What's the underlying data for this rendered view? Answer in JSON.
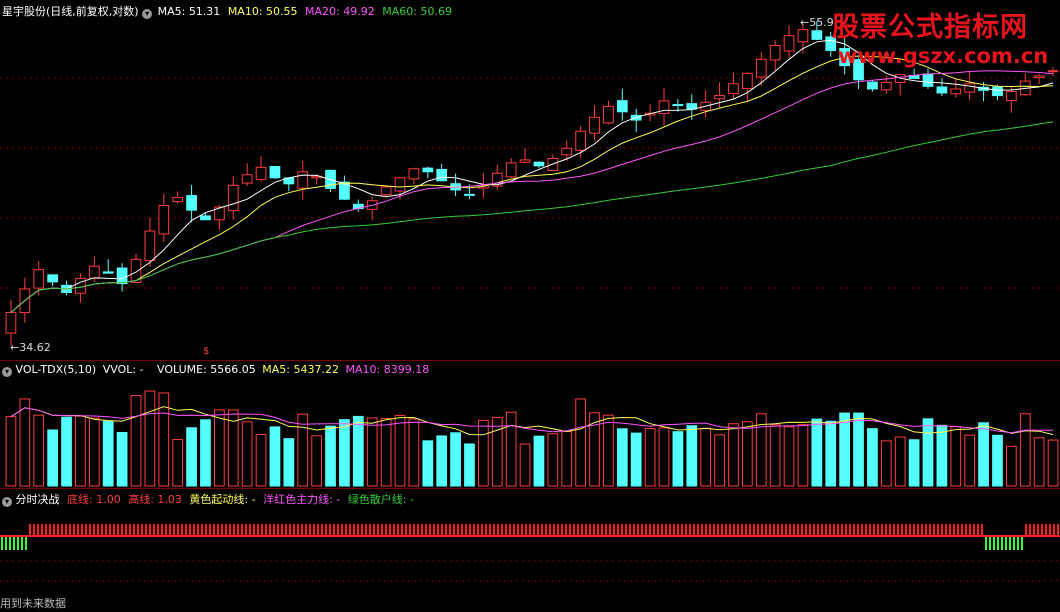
{
  "colors": {
    "up": "#ff3b3b",
    "down": "#54ffff",
    "ma5": "#ffffff",
    "ma10": "#ffff55",
    "ma20": "#ff55ff",
    "ma60": "#33cc33",
    "grid": "#7a0000"
  },
  "header": {
    "title": "星宇股份(日线,前复权,对数)",
    "ma5_label": "MA5:",
    "ma5": "51.31",
    "ma10_label": "MA10:",
    "ma10": "50.55",
    "ma20_label": "MA20:",
    "ma20": "49.92",
    "ma60_label": "MA60:",
    "ma60": "50.69"
  },
  "price_chart": {
    "high_label": "55.9",
    "low_label": "34.62",
    "marker": "$"
  },
  "volume": {
    "indicator": "VOL-TDX(5,10)",
    "vvol": "VVOL: -",
    "volume": "VOLUME: 5566.05",
    "ma5": "MA5: 5437.22",
    "ma10": "MA10: 8399.18"
  },
  "signal": {
    "title": "分时决战",
    "bottom": "底线: 1.00",
    "top": "高线: 1.03",
    "yellow": "黄色起动线: -",
    "magenta": "洋红色主力线: -",
    "green": "绿色散户线: -"
  },
  "footer": "用到未来数据",
  "watermark": {
    "line1": "股票公式指标网",
    "line2": "www.gszx.com.cn"
  },
  "chart_data": {
    "type": "candlestick",
    "closes": [
      36.5,
      37.8,
      38.9,
      38.2,
      37.6,
      38.4,
      39.1,
      38.7,
      38.1,
      39.5,
      41.2,
      42.8,
      43.3,
      42.5,
      41.9,
      42.7,
      44.1,
      44.8,
      45.3,
      44.6,
      44.2,
      45.0,
      44.7,
      43.9,
      43.2,
      42.6,
      43.1,
      44.0,
      44.6,
      45.2,
      45.0,
      44.4,
      43.8,
      43.5,
      44.1,
      44.9,
      45.6,
      45.8,
      45.4,
      45.9,
      46.6,
      47.8,
      48.8,
      49.6,
      49.2,
      48.6,
      49.1,
      50.0,
      49.7,
      49.4,
      49.9,
      50.4,
      51.3,
      52.1,
      53.2,
      54.3,
      55.1,
      55.6,
      54.8,
      53.9,
      52.7,
      51.6,
      50.9,
      51.4,
      52.0,
      51.7,
      51.1,
      50.6,
      50.9,
      51.3,
      50.8,
      50.4,
      50.7,
      51.5,
      51.9,
      52.3
    ],
    "high": 55.9,
    "low": 34.62,
    "ma_values": {
      "MA5": 51.31,
      "MA10": 50.55,
      "MA20": 49.92,
      "MA60": 50.69
    },
    "volume": {
      "VOLUME": 5566.05,
      "MA5": 5437.22,
      "MA10": 8399.18
    },
    "signal": {
      "bottom": 1.0,
      "top": 1.03
    }
  }
}
